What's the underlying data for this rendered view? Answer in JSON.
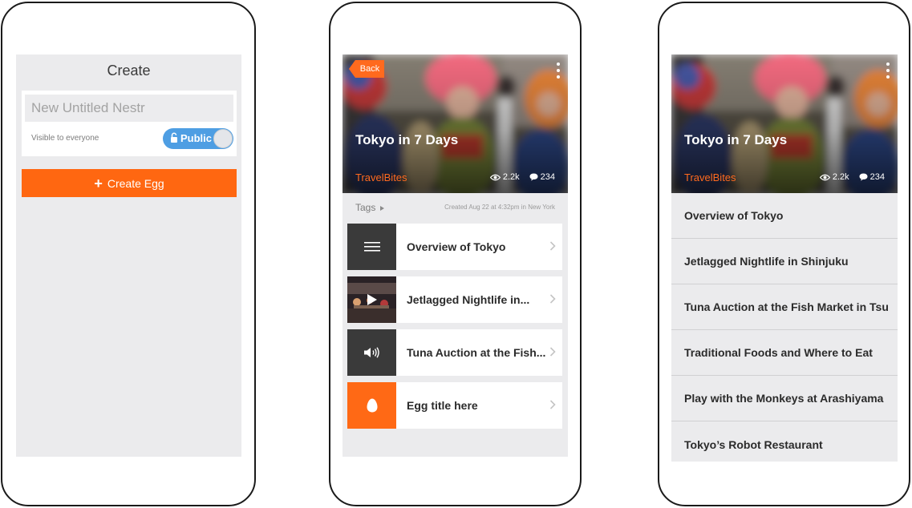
{
  "create_screen": {
    "title": "Create",
    "name_placeholder": "New Untitled Nestr",
    "visibility_label": "Visible to everyone",
    "toggle_label": "Public",
    "create_button_label": "Create Egg"
  },
  "detail_screen": {
    "back_label": "Back",
    "title": "Tokyo in 7 Days",
    "brand": "TravelBites",
    "views": "2.2k",
    "comments": "234",
    "tags_label": "Tags",
    "created_text": "Created Aug 22 at 4:32pm in New York",
    "items": [
      {
        "label": "Overview of Tokyo",
        "icon": "text-lines-icon"
      },
      {
        "label": "Jetlagged Nightlife in...",
        "icon": "play-icon"
      },
      {
        "label": "Tuna Auction at the Fish...",
        "icon": "speaker-icon"
      },
      {
        "label": "Egg title here",
        "icon": "egg-icon"
      }
    ]
  },
  "list_screen": {
    "title": "Tokyo in 7 Days",
    "brand": "TravelBites",
    "views": "2.2k",
    "comments": "234",
    "items": [
      "Overview of Tokyo",
      "Jetlagged Nightlife in Shinjuku",
      "Tuna Auction at the Fish Market in Tsu",
      "Traditional Foods and Where to Eat",
      "Play with the Monkeys at Arashiyama",
      "Tokyo’s Robot Restaurant"
    ]
  },
  "colors": {
    "accent": "#ff6711",
    "toggle_on": "#4e9ee3",
    "screen_bg": "#ebebed"
  }
}
